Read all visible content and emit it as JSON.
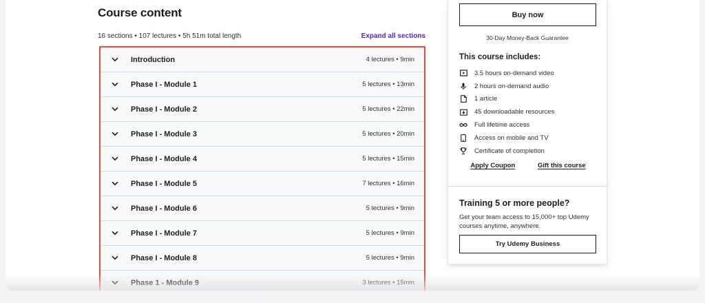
{
  "course_content": {
    "title": "Course content",
    "summary": "16 sections • 107 lectures • 5h 51m total length",
    "expand_label": "Expand all sections",
    "sections": [
      {
        "title": "Introduction",
        "info": "4 lectures • 9min"
      },
      {
        "title": "Phase I - Module 1",
        "info": "5 lectures • 13min"
      },
      {
        "title": "Phase I - Module 2",
        "info": "5 lectures • 22min"
      },
      {
        "title": "Phase I - Module 3",
        "info": "5 lectures • 20min"
      },
      {
        "title": "Phase I - Module 4",
        "info": "5 lectures • 15min"
      },
      {
        "title": "Phase I - Module 5",
        "info": "7 lectures • 16min"
      },
      {
        "title": "Phase I - Module 6",
        "info": "5 lectures • 9min"
      },
      {
        "title": "Phase I - Module 7",
        "info": "5 lectures • 9min"
      },
      {
        "title": "Phase I - Module 8",
        "info": "5 lectures • 9min"
      },
      {
        "title": "Phase 1 - Module 9",
        "info": "3 lectures • 15min"
      }
    ]
  },
  "purchase": {
    "buy_label": "Buy now",
    "guarantee": "30-Day Money-Back Guarantee",
    "includes_title": "This course includes:",
    "includes": [
      {
        "icon": "video-icon",
        "text": "3.5 hours on-demand video"
      },
      {
        "icon": "microphone-icon",
        "text": "2 hours on-demand audio"
      },
      {
        "icon": "article-icon",
        "text": "1 article"
      },
      {
        "icon": "download-icon",
        "text": "45 downloadable resources"
      },
      {
        "icon": "infinity-icon",
        "text": "Full lifetime access"
      },
      {
        "icon": "mobile-icon",
        "text": "Access on mobile and TV"
      },
      {
        "icon": "trophy-icon",
        "text": "Certificate of completion"
      }
    ],
    "apply_coupon": "Apply Coupon",
    "gift_course": "Gift this course"
  },
  "business": {
    "title": "Training 5 or more people?",
    "text": "Get your team access to 15,000+ top Udemy courses anytime, anywhere.",
    "button": "Try Udemy Business"
  },
  "colors": {
    "link_purple": "#5624d0",
    "highlight_red": "#e84a3a",
    "row_bg": "#f7f9fa"
  }
}
